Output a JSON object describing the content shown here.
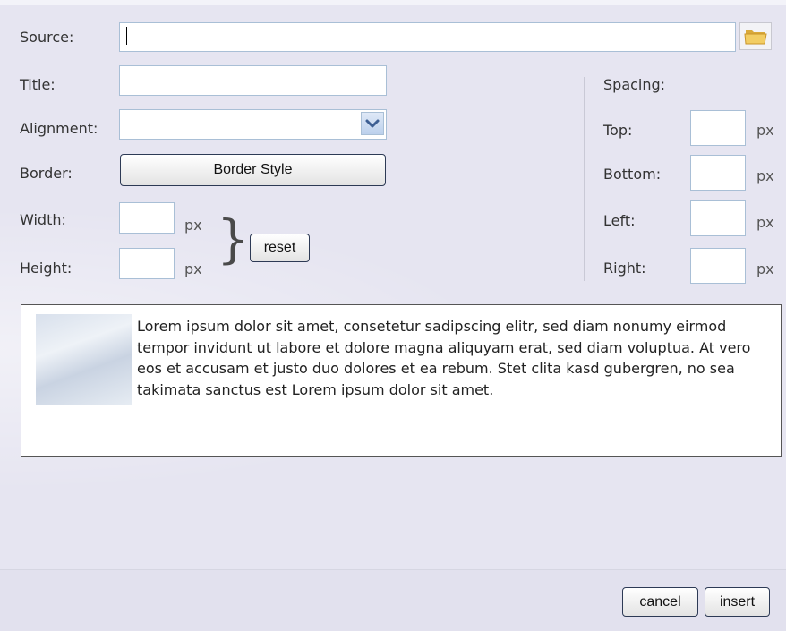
{
  "form": {
    "source_label": "Source:",
    "source_value": "",
    "title_label": "Title:",
    "title_value": "",
    "alignment_label": "Alignment:",
    "alignment_value": "",
    "border_label": "Border:",
    "border_button": "Border Style",
    "width_label": "Width:",
    "width_value": "",
    "height_label": "Height:",
    "height_value": "",
    "unit": "px",
    "reset_button": "reset"
  },
  "spacing": {
    "heading": "Spacing:",
    "top_label": "Top:",
    "bottom_label": "Bottom:",
    "left_label": "Left:",
    "right_label": "Right:",
    "unit": "px"
  },
  "preview": {
    "text": "Lorem ipsum dolor sit amet, consetetur sadipscing elitr, sed diam nonumy eirmod tempor invidunt ut labore et dolore magna aliquyam erat, sed diam voluptua. At vero eos et accusam et justo duo dolores et ea rebum. Stet clita kasd gubergren, no sea takimata sanctus est Lorem ipsum dolor sit amet."
  },
  "footer": {
    "cancel_button": "cancel",
    "insert_button": "insert"
  },
  "icons": {
    "browse": "folder-icon",
    "dropdown": "chevron-down-icon",
    "brace": "brace-icon"
  },
  "colors": {
    "background": "#e6e5f1",
    "field_border": "#a9bfd6",
    "button_border": "#2d3a55"
  }
}
